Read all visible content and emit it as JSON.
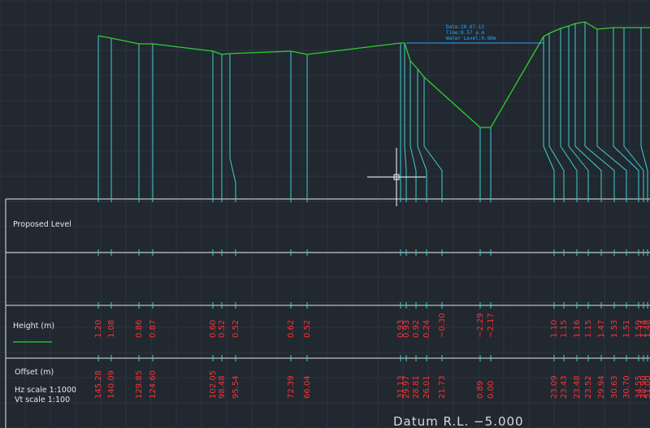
{
  "annotation": {
    "date": "Date:20.07.13",
    "time": "Time:8.57 a.m",
    "water_level": "Water Level:0.90m"
  },
  "labels": {
    "proposed_level": "Proposed Level",
    "height": "Height (m)",
    "offset": "Offset (m)",
    "hz_scale": "Hz scale   1:1000",
    "vt_scale": "Vt scale   1:100",
    "datum": "Datum R.L. −5.000"
  },
  "heights": [
    "1.20",
    "1.08",
    "0.86",
    "0.87",
    "0.60",
    "0.52",
    "0.52",
    "0.62",
    "0.52",
    "0.93",
    "0.93",
    "0.92",
    "0.24",
    "−0.30",
    "−2.29",
    "−2.17",
    "1.10",
    "1.15",
    "1.16",
    "1.15",
    "1.47",
    "1.53",
    "1.51",
    "1.59",
    "1.74",
    "1.48"
  ],
  "offsets": [
    "145.28",
    "140.09",
    "129.85",
    "124.60",
    "102.05",
    "98.48",
    "95.54",
    "72.39",
    "66.04",
    "31.13",
    "29.97",
    "28.81",
    "26.01",
    "21.73",
    "0.89",
    "0.00",
    "23.09",
    "23.43",
    "23.48",
    "23.52",
    "29.94",
    "30.63",
    "30.70",
    "34.55",
    "38.90",
    "51.00"
  ],
  "colors": {
    "background": "#212830",
    "grid": "#2c3440",
    "profile": "#2fd12f",
    "station_lines": "#3fd0d0",
    "table_lines": "#e6e6e6",
    "values": "#ff3030",
    "annotation": "#23a8ff"
  }
}
